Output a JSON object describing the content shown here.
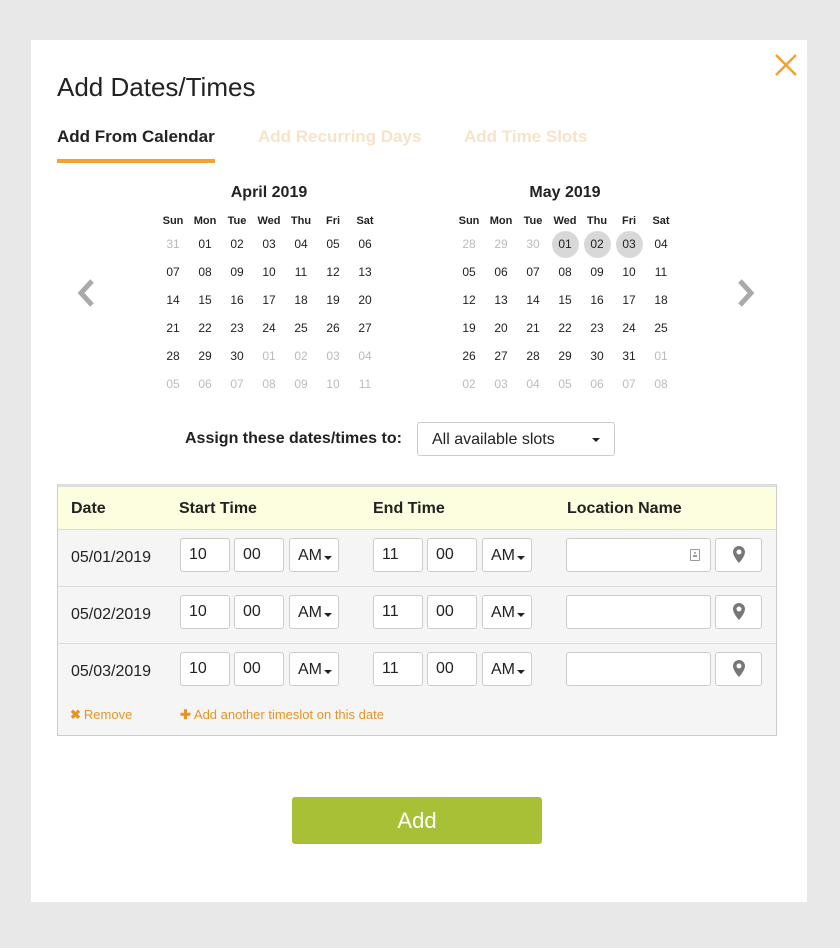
{
  "modal": {
    "title": "Add Dates/Times",
    "close_icon": "close-icon",
    "accent_color": "#f0a233"
  },
  "tabs": [
    {
      "label": "Add From Calendar",
      "active": true
    },
    {
      "label": "Add Recurring Days",
      "active": false
    },
    {
      "label": "Add Time Slots",
      "active": false
    }
  ],
  "calendar": {
    "prev_icon": "chevron-left-icon",
    "next_icon": "chevron-right-icon",
    "weekdays": [
      "Sun",
      "Mon",
      "Tue",
      "Wed",
      "Thu",
      "Fri",
      "Sat"
    ],
    "months": [
      {
        "title": "April 2019",
        "days": [
          {
            "d": "31",
            "other": true
          },
          {
            "d": "01"
          },
          {
            "d": "02"
          },
          {
            "d": "03"
          },
          {
            "d": "04"
          },
          {
            "d": "05"
          },
          {
            "d": "06"
          },
          {
            "d": "07"
          },
          {
            "d": "08"
          },
          {
            "d": "09"
          },
          {
            "d": "10"
          },
          {
            "d": "11"
          },
          {
            "d": "12"
          },
          {
            "d": "13"
          },
          {
            "d": "14"
          },
          {
            "d": "15"
          },
          {
            "d": "16"
          },
          {
            "d": "17"
          },
          {
            "d": "18"
          },
          {
            "d": "19"
          },
          {
            "d": "20"
          },
          {
            "d": "21"
          },
          {
            "d": "22"
          },
          {
            "d": "23"
          },
          {
            "d": "24"
          },
          {
            "d": "25"
          },
          {
            "d": "26"
          },
          {
            "d": "27"
          },
          {
            "d": "28"
          },
          {
            "d": "29"
          },
          {
            "d": "30"
          },
          {
            "d": "01",
            "other": true
          },
          {
            "d": "02",
            "other": true
          },
          {
            "d": "03",
            "other": true
          },
          {
            "d": "04",
            "other": true
          },
          {
            "d": "05",
            "other": true
          },
          {
            "d": "06",
            "other": true
          },
          {
            "d": "07",
            "other": true
          },
          {
            "d": "08",
            "other": true
          },
          {
            "d": "09",
            "other": true
          },
          {
            "d": "10",
            "other": true
          },
          {
            "d": "11",
            "other": true
          }
        ]
      },
      {
        "title": "May 2019",
        "days": [
          {
            "d": "28",
            "other": true
          },
          {
            "d": "29",
            "other": true
          },
          {
            "d": "30",
            "other": true
          },
          {
            "d": "01",
            "selected": true
          },
          {
            "d": "02",
            "selected": true
          },
          {
            "d": "03",
            "selected": true
          },
          {
            "d": "04"
          },
          {
            "d": "05"
          },
          {
            "d": "06"
          },
          {
            "d": "07"
          },
          {
            "d": "08"
          },
          {
            "d": "09"
          },
          {
            "d": "10"
          },
          {
            "d": "11"
          },
          {
            "d": "12"
          },
          {
            "d": "13"
          },
          {
            "d": "14"
          },
          {
            "d": "15"
          },
          {
            "d": "16"
          },
          {
            "d": "17"
          },
          {
            "d": "18"
          },
          {
            "d": "19"
          },
          {
            "d": "20"
          },
          {
            "d": "21"
          },
          {
            "d": "22"
          },
          {
            "d": "23"
          },
          {
            "d": "24"
          },
          {
            "d": "25"
          },
          {
            "d": "26"
          },
          {
            "d": "27"
          },
          {
            "d": "28"
          },
          {
            "d": "29"
          },
          {
            "d": "30"
          },
          {
            "d": "31"
          },
          {
            "d": "01",
            "other": true
          },
          {
            "d": "02",
            "other": true
          },
          {
            "d": "03",
            "other": true
          },
          {
            "d": "04",
            "other": true
          },
          {
            "d": "05",
            "other": true
          },
          {
            "d": "06",
            "other": true
          },
          {
            "d": "07",
            "other": true
          },
          {
            "d": "08",
            "other": true
          }
        ]
      }
    ]
  },
  "assign": {
    "label": "Assign these dates/times to:",
    "selected": "All available slots"
  },
  "table": {
    "headers": {
      "date": "Date",
      "start": "Start Time",
      "end": "End Time",
      "location": "Location Name"
    },
    "header_bg": "#fdfde0",
    "rows": [
      {
        "date": "05/01/2019",
        "start_h": "10",
        "start_m": "00",
        "start_ampm": "AM",
        "end_h": "11",
        "end_m": "00",
        "end_ampm": "AM",
        "location": ""
      },
      {
        "date": "05/02/2019",
        "start_h": "10",
        "start_m": "00",
        "start_ampm": "AM",
        "end_h": "11",
        "end_m": "00",
        "end_ampm": "AM",
        "location": ""
      },
      {
        "date": "05/03/2019",
        "start_h": "10",
        "start_m": "00",
        "start_ampm": "AM",
        "end_h": "11",
        "end_m": "00",
        "end_ampm": "AM",
        "location": ""
      }
    ],
    "remove_label": "Remove",
    "add_slot_label": "Add another timeslot on this date"
  },
  "footer": {
    "add_label": "Add",
    "add_color": "#a8c035"
  }
}
